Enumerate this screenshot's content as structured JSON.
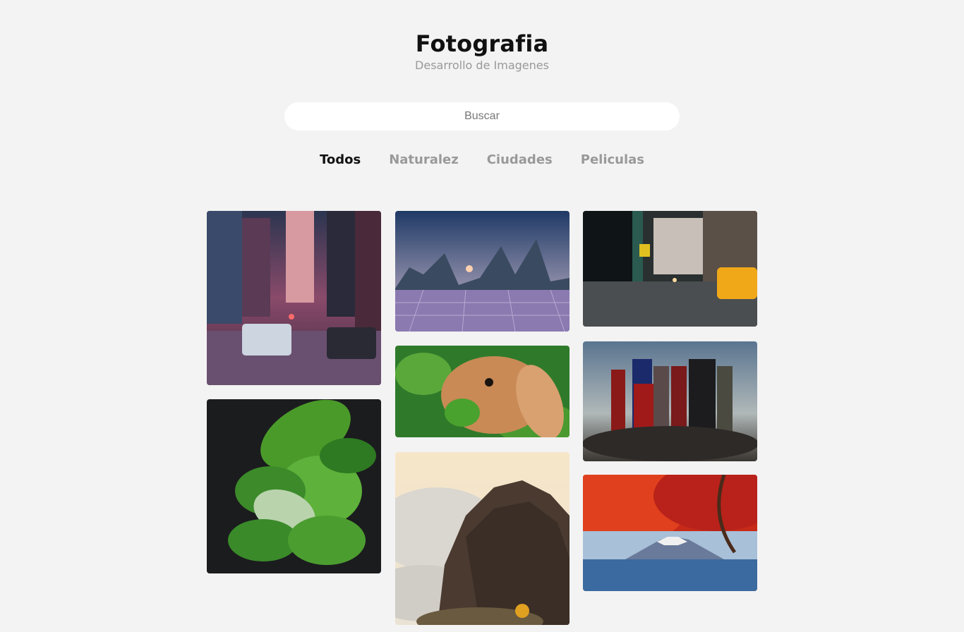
{
  "header": {
    "title": "Fotografia",
    "subtitle": "Desarrollo de Imagenes"
  },
  "search": {
    "placeholder": "Buscar",
    "value": ""
  },
  "tabs": [
    {
      "label": "Todos",
      "active": true
    },
    {
      "label": "Naturalez",
      "active": false
    },
    {
      "label": "Ciudades",
      "active": false
    },
    {
      "label": "Peliculas",
      "active": false
    }
  ],
  "gallery": [
    {
      "subject": "city-street-traffic",
      "category": "Ciudades"
    },
    {
      "subject": "futuristic-skyline-sunset",
      "category": "Ciudades"
    },
    {
      "subject": "rainy-street-taxi",
      "category": "Ciudades"
    },
    {
      "subject": "green-leaves",
      "category": "Naturalez"
    },
    {
      "subject": "rabbit",
      "category": "Naturalez"
    },
    {
      "subject": "superheroes",
      "category": "Peliculas"
    },
    {
      "subject": "mountain-clouds",
      "category": "Naturalez"
    },
    {
      "subject": "red-tree-mount-fuji",
      "category": "Naturalez"
    }
  ]
}
